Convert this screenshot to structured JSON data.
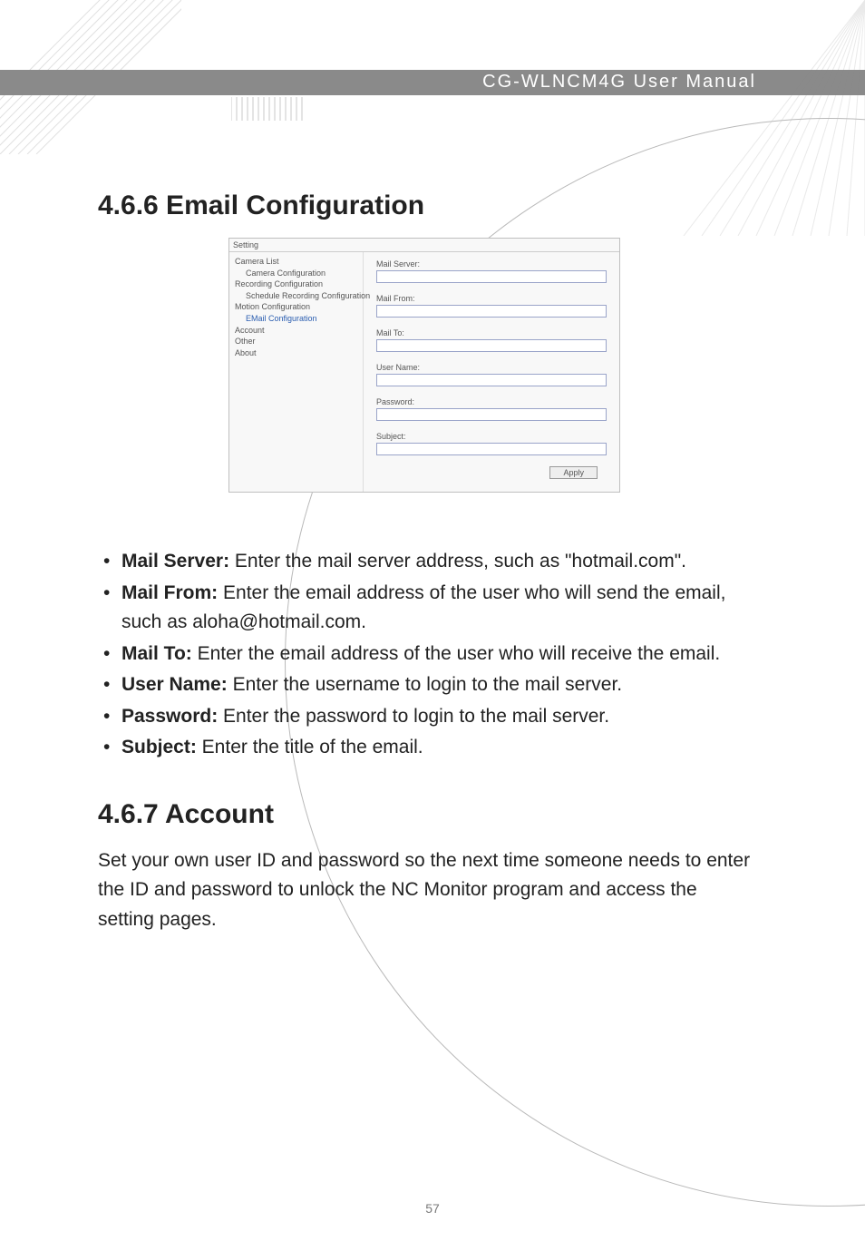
{
  "header": {
    "title": "CG-WLNCM4G User Manual"
  },
  "section1": {
    "heading": "4.6.6 Email Configuration",
    "fig": {
      "window_title": "Setting",
      "tree": [
        {
          "label": "Camera List",
          "sub": false
        },
        {
          "label": "Camera Configuration",
          "sub": true
        },
        {
          "label": "Recording Configuration",
          "sub": false
        },
        {
          "label": "Schedule Recording Configuration",
          "sub": true
        },
        {
          "label": "Motion Configuration",
          "sub": false
        },
        {
          "label": "EMail Configuration",
          "sub": true,
          "hl": true
        },
        {
          "label": "Account",
          "sub": false
        },
        {
          "label": "Other",
          "sub": false
        },
        {
          "label": "About",
          "sub": false
        }
      ],
      "fields": [
        {
          "label": "Mail Server:"
        },
        {
          "label": "Mail From:"
        },
        {
          "label": "Mail To:"
        },
        {
          "label": "User Name:"
        },
        {
          "label": "Password:"
        },
        {
          "label": "Subject:"
        }
      ],
      "apply": "Apply"
    },
    "bullets": [
      {
        "b": "Mail Server:",
        "t": " Enter the mail server address, such as \"hotmail.com\"."
      },
      {
        "b": "Mail From:",
        "t": " Enter the email address of the user who will send the email, such as aloha@hotmail.com."
      },
      {
        "b": "Mail To:",
        "t": " Enter the email address of the user who will receive the email."
      },
      {
        "b": "User Name:",
        "t": " Enter the username to login to the mail server."
      },
      {
        "b": "Password:",
        "t": " Enter the password to login to the mail server."
      },
      {
        "b": "Subject:",
        "t": " Enter the title of the email."
      }
    ]
  },
  "section2": {
    "heading": "4.6.7 Account",
    "para": "Set your own user ID and password so the next time someone needs to enter the ID and password to unlock the NC Monitor program and access the setting pages."
  },
  "page": "57"
}
